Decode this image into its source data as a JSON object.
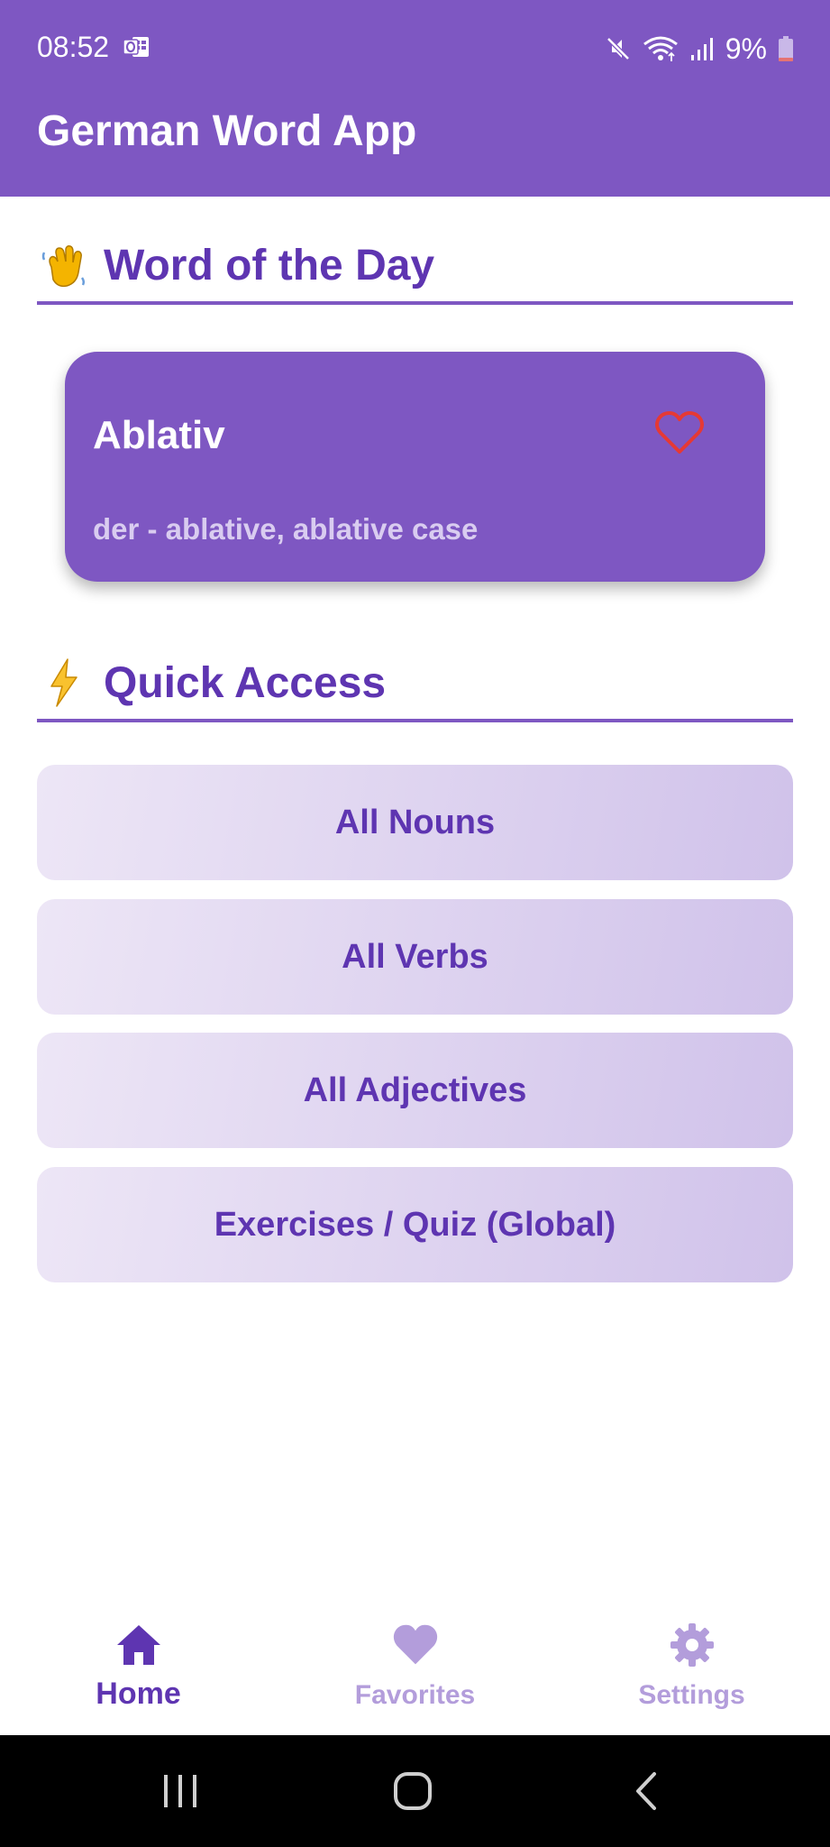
{
  "status_bar": {
    "time": "08:52",
    "battery_percent": "9%",
    "icons": [
      "outlook-icon",
      "mute-icon",
      "wifi-icon",
      "signal-icon",
      "battery-icon"
    ]
  },
  "app": {
    "title": "German Word App"
  },
  "word_of_the_day": {
    "emoji": "waving-hand-icon",
    "heading": "Word of the Day",
    "word": "Ablativ",
    "meaning": "der - ablative, ablative case",
    "favorite_icon": "heart-outline-icon"
  },
  "quick_access": {
    "emoji": "lightning-icon",
    "heading": "Quick Access",
    "buttons": [
      {
        "label": "All Nouns"
      },
      {
        "label": "All Verbs"
      },
      {
        "label": "All Adjectives"
      },
      {
        "label": "Exercises / Quiz (Global)"
      }
    ]
  },
  "bottom_nav": {
    "items": [
      {
        "label": "Home",
        "icon": "home-icon",
        "active": true
      },
      {
        "label": "Favorites",
        "icon": "heart-icon",
        "active": false
      },
      {
        "label": "Settings",
        "icon": "gear-icon",
        "active": false
      }
    ]
  },
  "colors": {
    "primary": "#7e57c2",
    "primary_dark": "#5e35b1",
    "light_accent": "#b39ddb",
    "heart": "#e53935"
  }
}
